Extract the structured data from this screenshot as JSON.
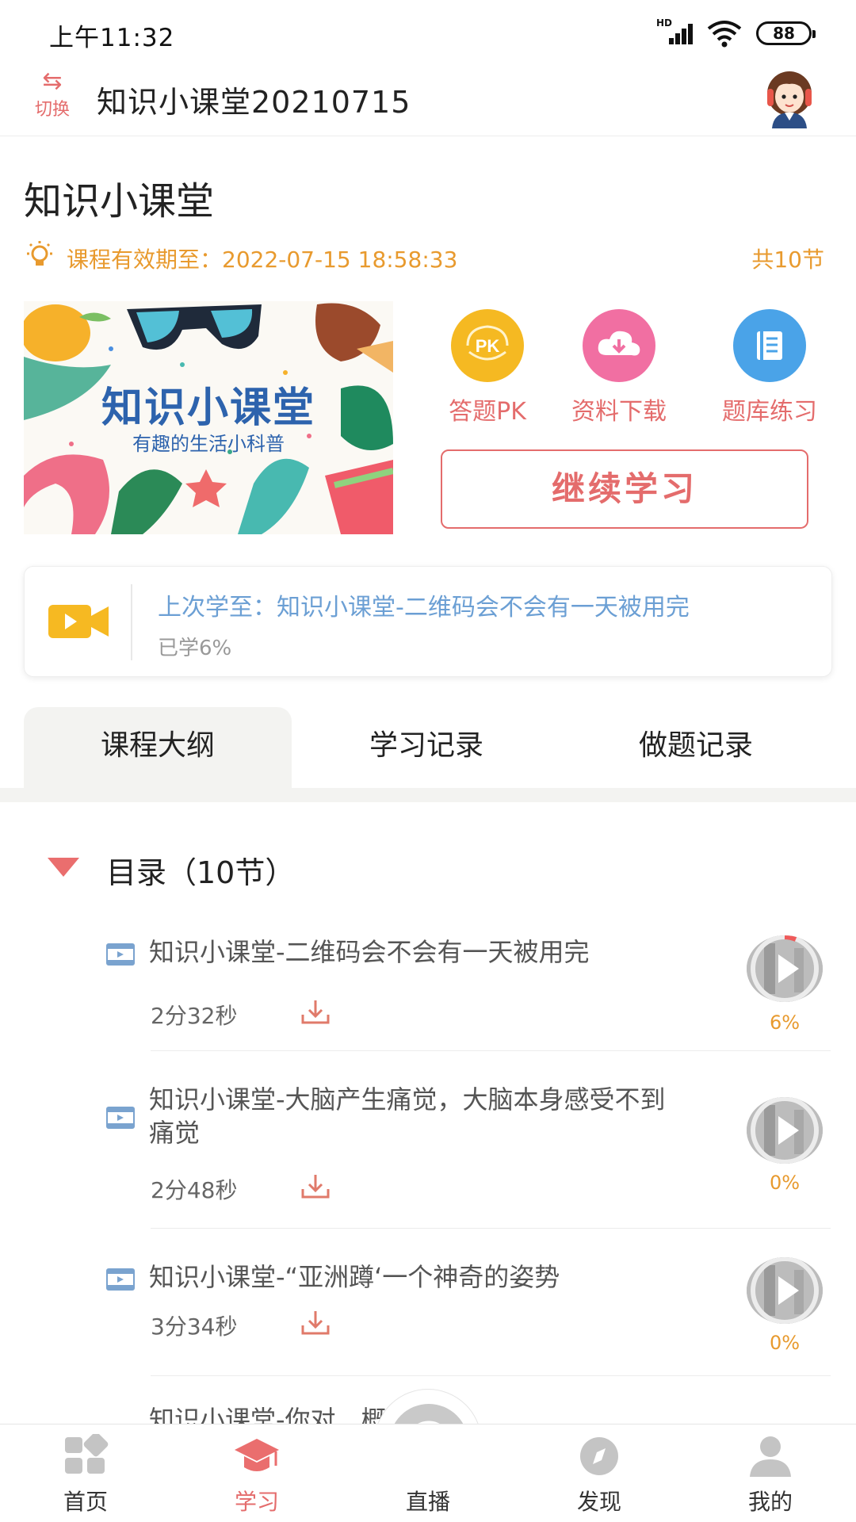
{
  "status_bar": {
    "time": "上午11:32",
    "battery": "88",
    "network": "HD"
  },
  "header": {
    "switch_label": "切换",
    "title": "知识小课堂20210715"
  },
  "course": {
    "title": "知识小课堂",
    "valid_until": "课程有效期至：2022-07-15 18:58:33",
    "total_sections": "共10节"
  },
  "banner": {
    "title": "知识小课堂",
    "subtitle": "有趣的生活小科普"
  },
  "quick_actions": [
    {
      "label": "答题PK",
      "icon": "pk-icon",
      "badge": "PK",
      "color": "#f5b922"
    },
    {
      "label": "资料下载",
      "icon": "cloud-download-icon",
      "color": "#f16fa2"
    },
    {
      "label": "题库练习",
      "icon": "book-icon",
      "color": "#4aa3e8"
    }
  ],
  "continue_label": "继续学习",
  "last_studied": {
    "title": "上次学至：知识小课堂-二维码会不会有一天被用完",
    "progress": "已学6%"
  },
  "tabs": [
    {
      "label": "课程大纲",
      "active": true
    },
    {
      "label": "学习记录",
      "active": false
    },
    {
      "label": "做题记录",
      "active": false
    }
  ],
  "outline": {
    "heading": "目录（10节）",
    "lessons": [
      {
        "title": "知识小课堂-二维码会不会有一天被用完",
        "duration": "2分32秒",
        "progress": "6%"
      },
      {
        "title": "知识小课堂-大脑产生痛觉，大脑本身感受不到痛觉",
        "duration": "2分48秒",
        "progress": "0%"
      },
      {
        "title": "知识小课堂-“亚洲蹲‘一个神奇的姿势",
        "duration": "3分34秒",
        "progress": "0%"
      },
      {
        "title": "知识小课堂-你对…概念么？",
        "duration": "",
        "progress": ""
      }
    ]
  },
  "bottom_nav": [
    {
      "label": "首页",
      "icon": "home-grid-icon",
      "active": false
    },
    {
      "label": "学习",
      "icon": "graduation-cap-icon",
      "active": true
    },
    {
      "label": "直播",
      "icon": "live-play-icon",
      "active": false
    },
    {
      "label": "发现",
      "icon": "compass-icon",
      "active": false
    },
    {
      "label": "我的",
      "icon": "user-icon",
      "active": false
    }
  ],
  "colors": {
    "accent": "#e46c6c",
    "orange": "#e89a2e",
    "link": "#6b9fd4"
  }
}
